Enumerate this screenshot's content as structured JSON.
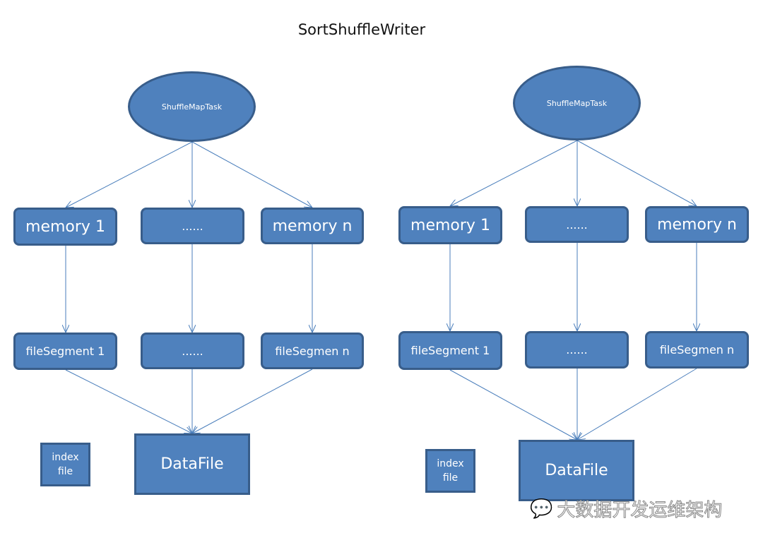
{
  "title": "SortShuffleWriter",
  "diagrams": [
    {
      "task": "ShuffleMapTask",
      "memory": [
        "memory 1",
        "......",
        "memory n"
      ],
      "segments": [
        "fileSegment 1",
        "......",
        "fileSegmen n"
      ],
      "datafile": "DataFile",
      "index": [
        "index",
        "file"
      ]
    },
    {
      "task": "ShuffleMapTask",
      "memory": [
        "memory 1",
        "......",
        "memory n"
      ],
      "segments": [
        "fileSegment 1",
        "......",
        "fileSegmen n"
      ],
      "datafile": "DataFile",
      "index": [
        "index",
        "file"
      ]
    }
  ],
  "watermark": "大数据开发运维架构",
  "colors": {
    "fill": "#4f81bd",
    "border": "#385d8a",
    "line": "#4a7ebb"
  }
}
